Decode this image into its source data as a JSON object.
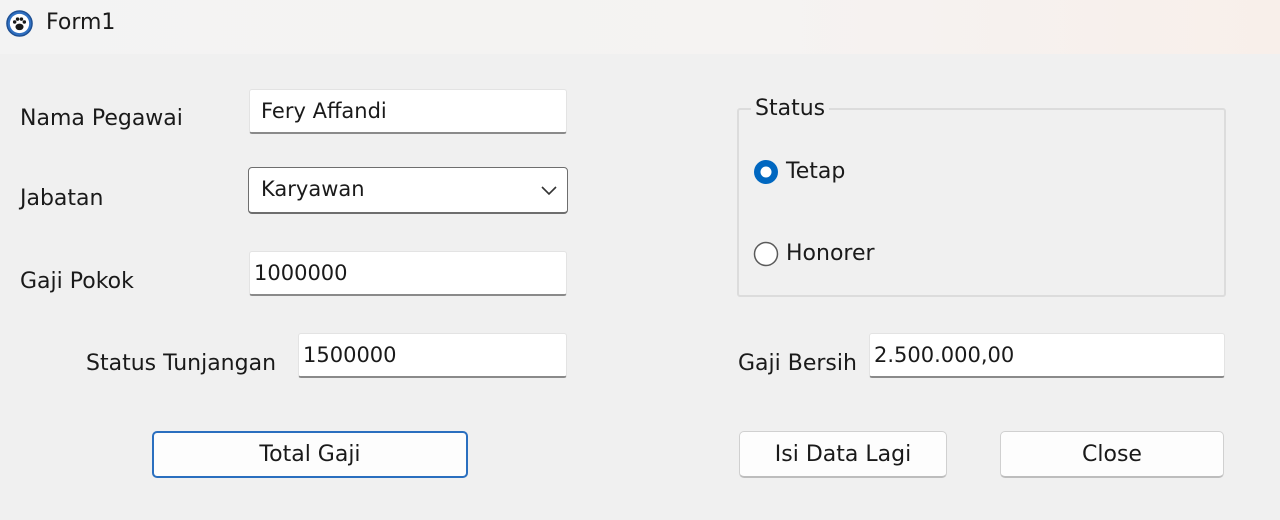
{
  "window": {
    "title": "Form1",
    "icon": "paw-icon"
  },
  "form": {
    "nama_label": "Nama Pegawai",
    "nama_value": "Fery Affandi",
    "jabatan_label": "Jabatan",
    "jabatan_selected": "Karyawan",
    "gaji_pokok_label": "Gaji Pokok",
    "gaji_pokok_value": "1000000",
    "tunjangan_label": "Status Tunjangan",
    "tunjangan_value": "1500000",
    "gaji_bersih_label": "Gaji Bersih",
    "gaji_bersih_value": "2.500.000,00"
  },
  "status": {
    "title": "Status",
    "options": [
      {
        "label": "Tetap",
        "checked": true
      },
      {
        "label": "Honorer",
        "checked": false
      }
    ]
  },
  "buttons": {
    "total": "Total Gaji",
    "isi_lagi": "Isi Data Lagi",
    "close": "Close"
  },
  "colors": {
    "accent": "#0067c0",
    "default_button_border": "#2a6fbf"
  }
}
